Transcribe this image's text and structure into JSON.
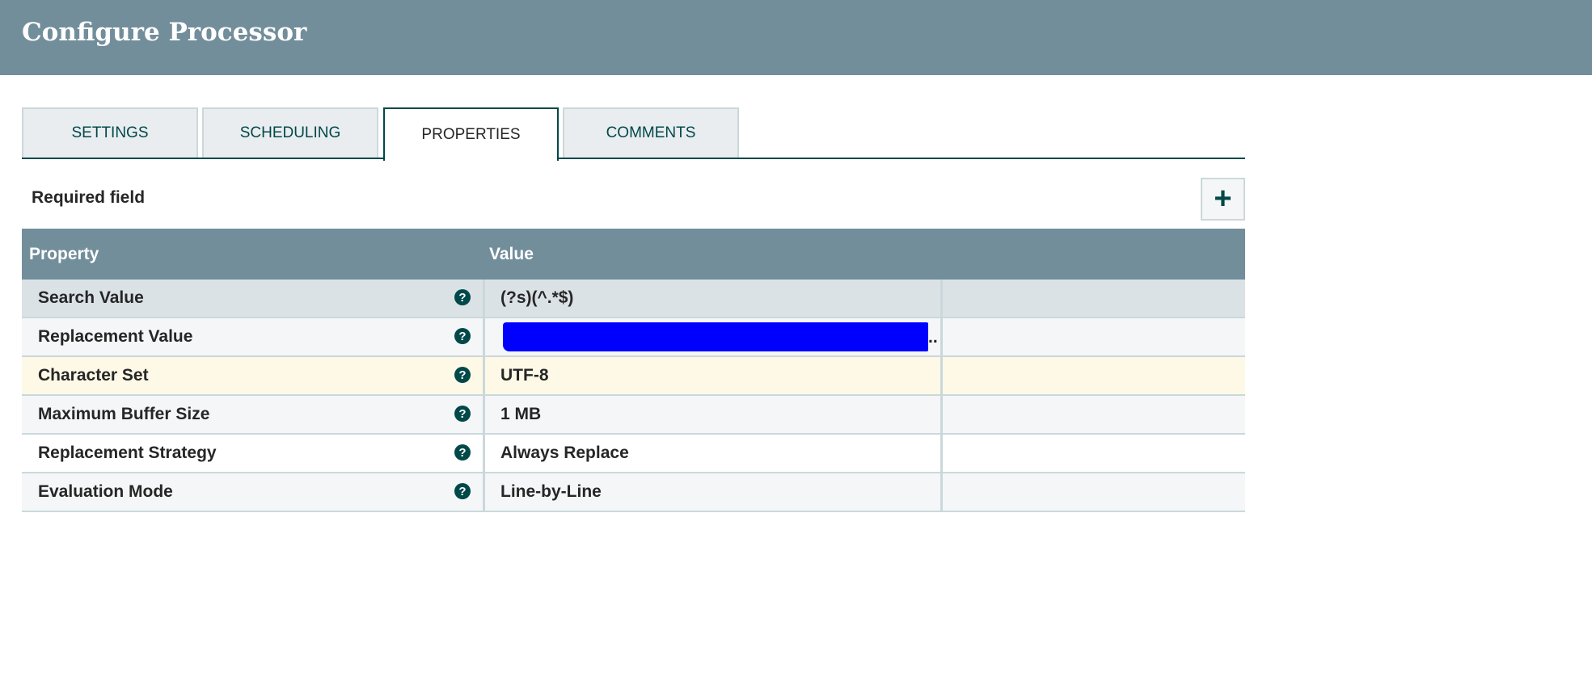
{
  "header": {
    "title": "Configure Processor"
  },
  "tabs": [
    {
      "label": "SETTINGS"
    },
    {
      "label": "SCHEDULING"
    },
    {
      "label": "PROPERTIES",
      "active": true
    },
    {
      "label": "COMMENTS"
    }
  ],
  "required_label": "Required field",
  "add_button": {
    "icon": "plus-icon",
    "label": "+"
  },
  "table": {
    "headers": {
      "property": "Property",
      "value": "Value"
    },
    "rows": [
      {
        "name": "Search Value",
        "value": "(?s)(^.*$)",
        "bg": "#dbe2e6"
      },
      {
        "name": "Replacement Value",
        "value": "",
        "redacted": true,
        "ellipsis": "..",
        "bg": "#f4f6f7"
      },
      {
        "name": "Character Set",
        "value": "UTF-8",
        "bg": "#fdf9e6"
      },
      {
        "name": "Maximum Buffer Size",
        "value": "1 MB",
        "bg": "#f4f6f7"
      },
      {
        "name": "Replacement Strategy",
        "value": "Always Replace",
        "bg": "#ffffff"
      },
      {
        "name": "Evaluation Mode",
        "value": "Line-by-Line",
        "bg": "#f4f6f7"
      }
    ],
    "help_glyph": "?"
  }
}
